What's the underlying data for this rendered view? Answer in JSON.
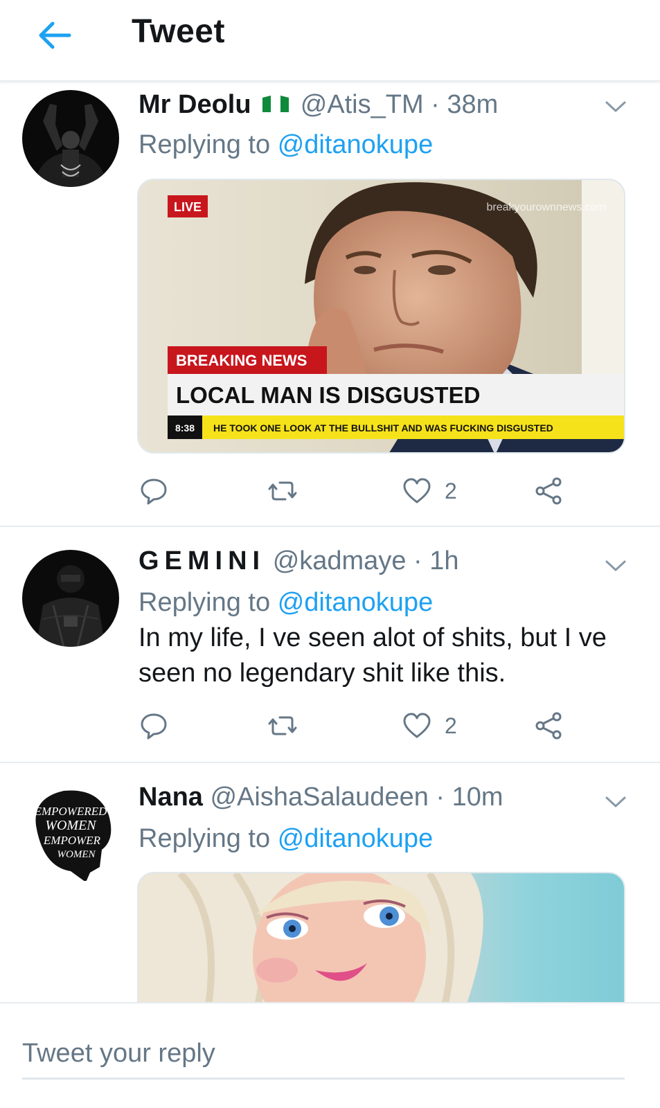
{
  "header": {
    "title": "Tweet",
    "back_icon": "arrow-left-icon"
  },
  "colors": {
    "accent": "#1da1f2",
    "secondary_text": "#657786",
    "primary_text": "#14171a",
    "divider": "#e6ecf0",
    "news_red": "#c8161d",
    "news_yellow": "#f6e21a"
  },
  "tweets": [
    {
      "name": "Mr Deolu",
      "handle": "@Atis_TM",
      "dot": "·",
      "time": "38m",
      "replying_prefix": "Replying to",
      "replying_to": "@ditanokupe",
      "text": "",
      "media": {
        "type": "breaking-news-meme",
        "live": "LIVE",
        "watermark": "breakyourownnews.com",
        "breaking": "BREAKING NEWS",
        "headline": "LOCAL MAN IS DISGUSTED",
        "clock": "8:38",
        "ticker": "HE TOOK ONE LOOK AT THE BULLSHIT AND WAS FUCKING DISGUSTED"
      },
      "likes": "2"
    },
    {
      "name": "GEMINI",
      "handle": "@kadmaye",
      "dot": "·",
      "time": "1h",
      "replying_prefix": "Replying to",
      "replying_to": "@ditanokupe",
      "text": "In my life, I ve seen alot of shits, but I ve seen no legendary shit like this.",
      "likes": "2"
    },
    {
      "name": "Nana",
      "handle": "@AishaSalaudeen",
      "dot": "·",
      "time": "10m",
      "replying_prefix": "Replying to",
      "replying_to": "@ditanokupe",
      "avatar_text": [
        "EMPOWERED",
        "WOMEN",
        "EMPOWER",
        "WOMEN"
      ],
      "media": {
        "type": "doll-photo"
      }
    }
  ],
  "reply": {
    "placeholder": "Tweet your reply"
  }
}
